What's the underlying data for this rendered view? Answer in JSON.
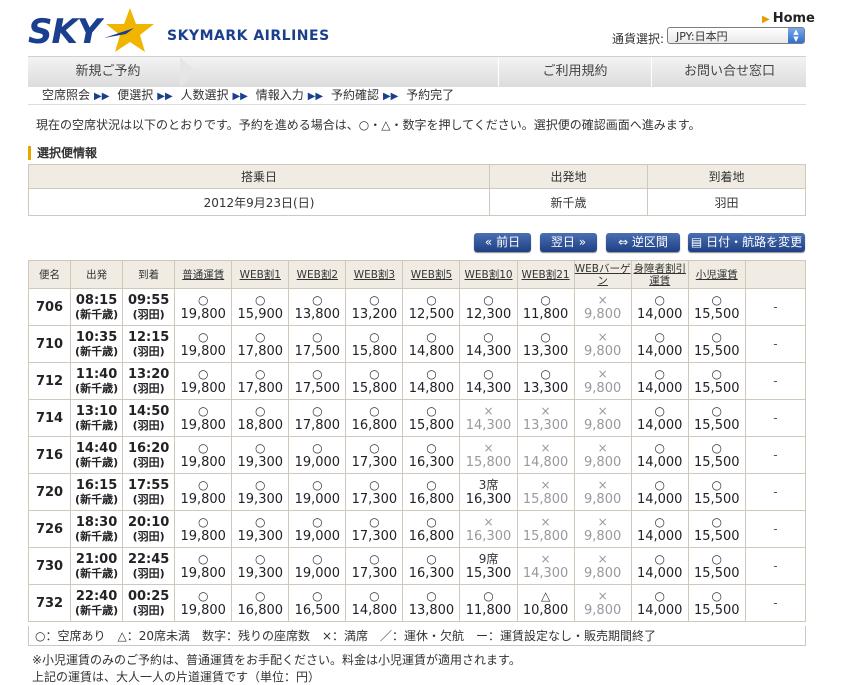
{
  "header": {
    "logo_sky": "SKY",
    "logo_text": "SKYMARK AIRLINES",
    "home_label": "Home",
    "currency_label": "通貨選択:",
    "currency_value": "JPY:日本円"
  },
  "nav": {
    "new_booking": "新規ご予約",
    "terms": "ご利用規約",
    "contact": "お問い合せ窓口"
  },
  "steps": [
    "空席照会",
    "便選択",
    "人数選択",
    "情報入力",
    "予約確認",
    "予約完了"
  ],
  "notice": "現在の空席状況は以下のとおりです。予約を進める場合は、○・△・数字を押してください。選択便の確認画面へ進みます。",
  "selected_flight": {
    "title": "選択便情報",
    "headers": [
      "搭乗日",
      "出発地",
      "到着地"
    ],
    "values": [
      "2012年9月23日(日)",
      "新千歳",
      "羽田"
    ]
  },
  "buttons": {
    "prev_day": "« 前日",
    "next_day": "翌日 »",
    "reverse": "⇔ 逆区間",
    "change": "日付・航路を変更"
  },
  "flights_table": {
    "headers": [
      "便名",
      "出発",
      "到着",
      "普通運賃",
      "WEB割1",
      "WEB割2",
      "WEB割3",
      "WEB割5",
      "WEB割10",
      "WEB割21",
      "WEBバーゲン",
      "身障者割引運賃",
      "小児運賃",
      ""
    ],
    "rows": [
      {
        "no": "706",
        "dep": "08:15",
        "dep_ap": "(新千歳)",
        "arr": "09:55",
        "arr_ap": "(羽田)",
        "fares": [
          [
            "○",
            "19,800"
          ],
          [
            "○",
            "15,900"
          ],
          [
            "○",
            "13,800"
          ],
          [
            "○",
            "13,200"
          ],
          [
            "○",
            "12,500"
          ],
          [
            "○",
            "12,300"
          ],
          [
            "○",
            "11,800"
          ],
          [
            "×",
            "9,800"
          ],
          [
            "○",
            "14,000"
          ],
          [
            "○",
            "15,500"
          ]
        ],
        "last": "-"
      },
      {
        "no": "710",
        "dep": "10:35",
        "dep_ap": "(新千歳)",
        "arr": "12:15",
        "arr_ap": "(羽田)",
        "fares": [
          [
            "○",
            "19,800"
          ],
          [
            "○",
            "17,800"
          ],
          [
            "○",
            "17,500"
          ],
          [
            "○",
            "15,800"
          ],
          [
            "○",
            "14,800"
          ],
          [
            "○",
            "14,300"
          ],
          [
            "○",
            "13,300"
          ],
          [
            "×",
            "9,800"
          ],
          [
            "○",
            "14,000"
          ],
          [
            "○",
            "15,500"
          ]
        ],
        "last": "-"
      },
      {
        "no": "712",
        "dep": "11:40",
        "dep_ap": "(新千歳)",
        "arr": "13:20",
        "arr_ap": "(羽田)",
        "fares": [
          [
            "○",
            "19,800"
          ],
          [
            "○",
            "17,800"
          ],
          [
            "○",
            "17,500"
          ],
          [
            "○",
            "15,800"
          ],
          [
            "○",
            "14,800"
          ],
          [
            "○",
            "14,300"
          ],
          [
            "○",
            "13,300"
          ],
          [
            "×",
            "9,800"
          ],
          [
            "○",
            "14,000"
          ],
          [
            "○",
            "15,500"
          ]
        ],
        "last": "-"
      },
      {
        "no": "714",
        "dep": "13:10",
        "dep_ap": "(新千歳)",
        "arr": "14:50",
        "arr_ap": "(羽田)",
        "fares": [
          [
            "○",
            "19,800"
          ],
          [
            "○",
            "18,800"
          ],
          [
            "○",
            "17,800"
          ],
          [
            "○",
            "16,800"
          ],
          [
            "○",
            "15,800"
          ],
          [
            "×",
            "14,300"
          ],
          [
            "×",
            "13,300"
          ],
          [
            "×",
            "9,800"
          ],
          [
            "○",
            "14,000"
          ],
          [
            "○",
            "15,500"
          ]
        ],
        "last": "-"
      },
      {
        "no": "716",
        "dep": "14:40",
        "dep_ap": "(新千歳)",
        "arr": "16:20",
        "arr_ap": "(羽田)",
        "fares": [
          [
            "○",
            "19,800"
          ],
          [
            "○",
            "19,300"
          ],
          [
            "○",
            "19,000"
          ],
          [
            "○",
            "17,300"
          ],
          [
            "○",
            "16,300"
          ],
          [
            "×",
            "15,800"
          ],
          [
            "×",
            "14,800"
          ],
          [
            "×",
            "9,800"
          ],
          [
            "○",
            "14,000"
          ],
          [
            "○",
            "15,500"
          ]
        ],
        "last": "-"
      },
      {
        "no": "720",
        "dep": "16:15",
        "dep_ap": "(新千歳)",
        "arr": "17:55",
        "arr_ap": "(羽田)",
        "fares": [
          [
            "○",
            "19,800"
          ],
          [
            "○",
            "19,300"
          ],
          [
            "○",
            "19,000"
          ],
          [
            "○",
            "17,300"
          ],
          [
            "○",
            "16,800"
          ],
          [
            "3席",
            "16,300"
          ],
          [
            "×",
            "15,800"
          ],
          [
            "×",
            "9,800"
          ],
          [
            "○",
            "14,000"
          ],
          [
            "○",
            "15,500"
          ]
        ],
        "last": "-"
      },
      {
        "no": "726",
        "dep": "18:30",
        "dep_ap": "(新千歳)",
        "arr": "20:10",
        "arr_ap": "(羽田)",
        "fares": [
          [
            "○",
            "19,800"
          ],
          [
            "○",
            "19,300"
          ],
          [
            "○",
            "19,000"
          ],
          [
            "○",
            "17,300"
          ],
          [
            "○",
            "16,800"
          ],
          [
            "×",
            "16,300"
          ],
          [
            "×",
            "15,800"
          ],
          [
            "×",
            "9,800"
          ],
          [
            "○",
            "14,000"
          ],
          [
            "○",
            "15,500"
          ]
        ],
        "last": "-"
      },
      {
        "no": "730",
        "dep": "21:00",
        "dep_ap": "(新千歳)",
        "arr": "22:45",
        "arr_ap": "(羽田)",
        "fares": [
          [
            "○",
            "19,800"
          ],
          [
            "○",
            "19,300"
          ],
          [
            "○",
            "19,000"
          ],
          [
            "○",
            "17,300"
          ],
          [
            "○",
            "16,300"
          ],
          [
            "9席",
            "15,300"
          ],
          [
            "×",
            "14,300"
          ],
          [
            "×",
            "9,800"
          ],
          [
            "○",
            "14,000"
          ],
          [
            "○",
            "15,500"
          ]
        ],
        "last": "-"
      },
      {
        "no": "732",
        "dep": "22:40",
        "dep_ap": "(新千歳)",
        "arr": "00:25",
        "arr_ap": "(羽田)",
        "fares": [
          [
            "○",
            "19,800"
          ],
          [
            "○",
            "16,800"
          ],
          [
            "○",
            "16,500"
          ],
          [
            "○",
            "14,800"
          ],
          [
            "○",
            "13,800"
          ],
          [
            "○",
            "11,800"
          ],
          [
            "△",
            "10,800"
          ],
          [
            "×",
            "9,800"
          ],
          [
            "○",
            "14,000"
          ],
          [
            "○",
            "15,500"
          ]
        ],
        "last": "-"
      }
    ]
  },
  "legend": "○：空席あり　△：20席未満　数字：残りの座席数　×：満席　／：運休・欠航　ー：運賃設定なし・販売期間終了",
  "notes": [
    "※小児運賃のみのご予約は、普通運賃をお手配ください。料金は小児運賃が適用されます。",
    "上記の運賃は、大人一人の片道運賃です（単位：円）"
  ],
  "colors": {
    "brand": "#1a3f8f",
    "accent": "#e8a700",
    "button": "#1e3f84"
  }
}
